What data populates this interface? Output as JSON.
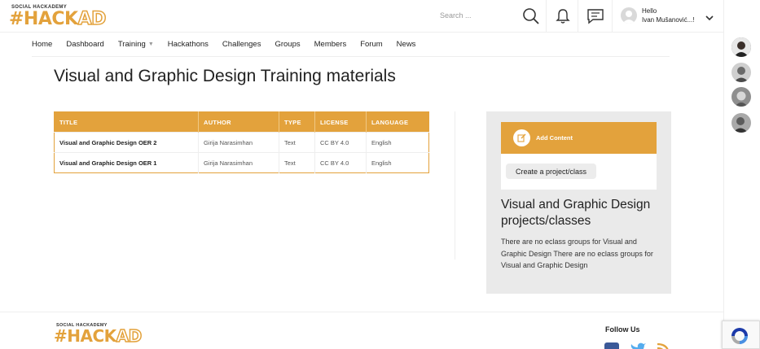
{
  "header": {
    "logo_top": "SOCIAL HACKADEMY",
    "logo_hash": "#HACK",
    "logo_ad": "AD",
    "search_placeholder": "Search ...",
    "hello": "Hello",
    "user_name": "Ivan Mušanović...!"
  },
  "nav": {
    "items": [
      "Home",
      "Dashboard",
      "Training",
      "Hackathons",
      "Challenges",
      "Groups",
      "Members",
      "Forum",
      "News"
    ]
  },
  "page_title": "Visual and Graphic Design Training materials",
  "table": {
    "headers": [
      "TITLE",
      "AUTHOR",
      "TYPE",
      "LICENSE",
      "LANGUAGE"
    ],
    "rows": [
      [
        "Visual and Graphic Design OER 2",
        "Girija Narasimhan",
        "Text",
        "CC BY 4.0",
        "English"
      ],
      [
        "Visual and Graphic Design OER 1",
        "Girija Narasimhan",
        "Text",
        "CC BY 4.0",
        "English"
      ]
    ]
  },
  "sidebar": {
    "add_content": "Add Content",
    "create_button": "Create a project/class",
    "title": "Visual and Graphic Design projects/classes",
    "text": "There are no eclass groups for Visual and Graphic Design There are no eclass groups for Visual and Graphic Design"
  },
  "footer": {
    "logo_top": "SOCIAL HACKADEMY",
    "logo_hash": "#HACK",
    "logo_ad": "AD",
    "follow_us": "Follow Us"
  },
  "colors": {
    "accent": "#e3a23c",
    "sidebar_bg": "#eaeaea"
  },
  "icons": [
    "search-icon",
    "bell-icon",
    "chat-icon",
    "user-avatar-icon",
    "chevron-down-icon",
    "hamburger-menu-icon",
    "edit-icon",
    "facebook-icon",
    "twitter-icon",
    "rss-icon",
    "recaptcha-icon"
  ]
}
